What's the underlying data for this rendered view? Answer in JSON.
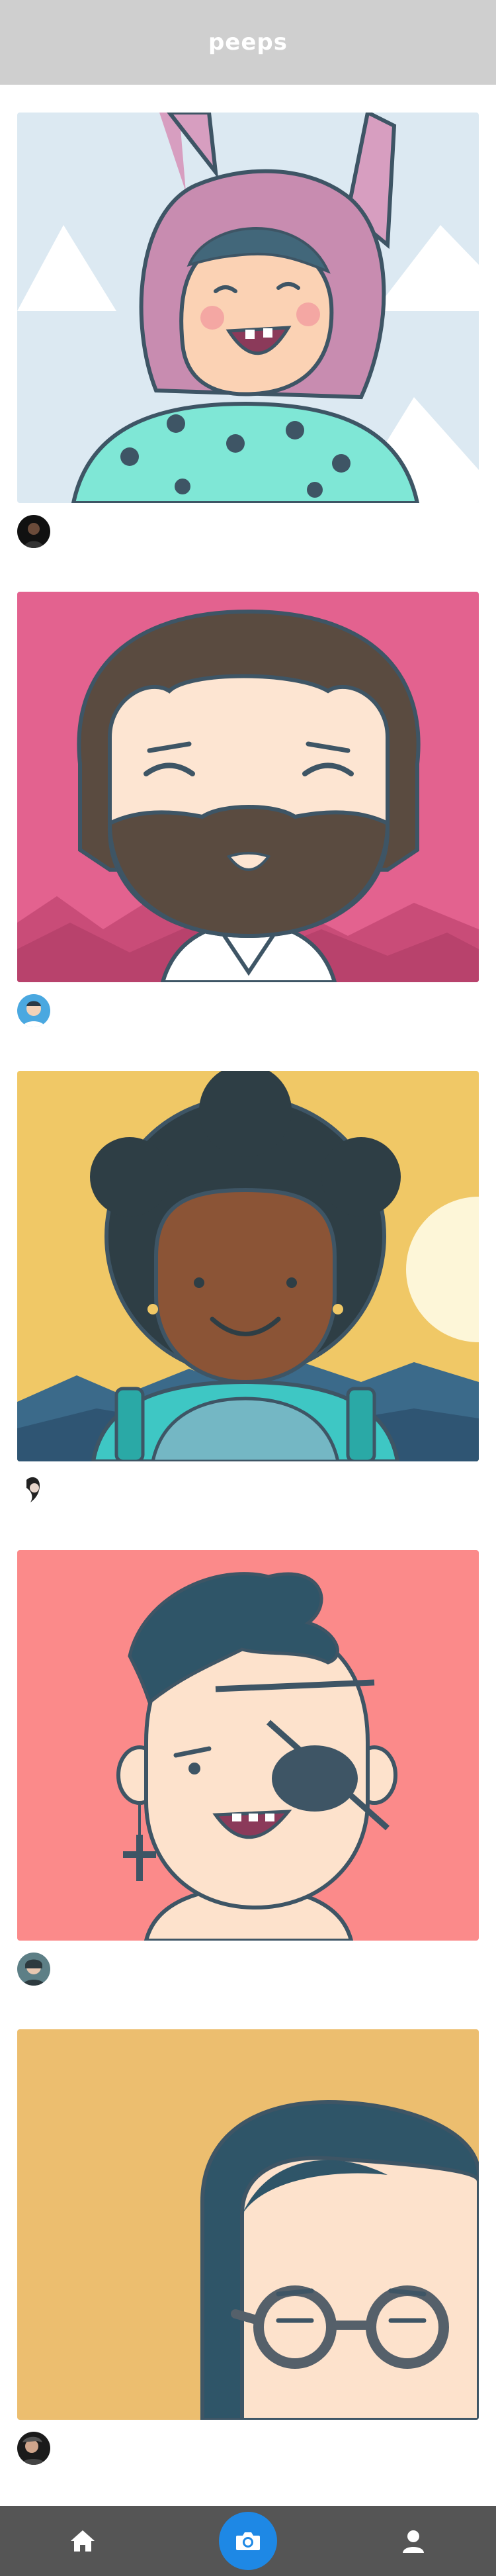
{
  "app": {
    "title": "peeps"
  },
  "feed": {
    "posts": [
      {
        "username": "",
        "image_icon": "bunny-hat-kid-illustration"
      },
      {
        "username": "",
        "image_icon": "bearded-man-illustration"
      },
      {
        "username": "",
        "image_icon": "afro-hiker-illustration"
      },
      {
        "username": "",
        "image_icon": "eyepatch-punk-illustration"
      },
      {
        "username": "",
        "image_icon": "glasses-woman-illustration"
      }
    ]
  },
  "tabbar": {
    "items": [
      {
        "name": "home",
        "icon": "home-icon"
      },
      {
        "name": "camera",
        "icon": "camera-icon"
      },
      {
        "name": "profile",
        "icon": "user-icon"
      }
    ]
  },
  "colors": {
    "header_bg": "#cfcfcf",
    "tabbar_bg": "#555555",
    "accent": "#1e88e5"
  }
}
